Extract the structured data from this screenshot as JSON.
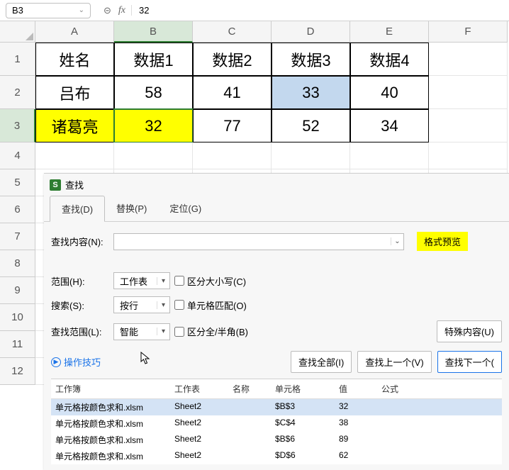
{
  "formula_bar": {
    "cell_ref": "B3",
    "value": "32"
  },
  "columns": [
    "A",
    "B",
    "C",
    "D",
    "E",
    "F"
  ],
  "selected_col": "B",
  "selected_row": 3,
  "grid": [
    [
      "姓名",
      "数据1",
      "数据2",
      "数据3",
      "数据4",
      ""
    ],
    [
      "吕布",
      "58",
      "41",
      "33",
      "40",
      ""
    ],
    [
      "诸葛亮",
      "32",
      "77",
      "52",
      "34",
      ""
    ]
  ],
  "dialog": {
    "title": "查找",
    "tabs": [
      "查找(D)",
      "替换(P)",
      "定位(G)"
    ],
    "find_label": "查找内容(N):",
    "format_preview": "格式预览",
    "scope_label": "范围(H):",
    "scope_value": "工作表",
    "search_label": "搜索(S):",
    "search_value": "按行",
    "lookin_label": "查找范围(L):",
    "lookin_value": "智能",
    "chk_case": "区分大小写(C)",
    "chk_match": "单元格匹配(O)",
    "chk_width": "区分全/半角(B)",
    "special_btn": "特殊内容(U)",
    "tips": "操作技巧",
    "find_all": "查找全部(I)",
    "find_prev": "查找上一个(V)",
    "find_next": "查找下一个("
  },
  "results": {
    "headers": {
      "wb": "工作簿",
      "ws": "工作表",
      "nm": "名称",
      "cell": "单元格",
      "val": "值",
      "fm": "公式"
    },
    "rows": [
      {
        "wb": "单元格按颜色求和.xlsm",
        "ws": "Sheet2",
        "nm": "",
        "cell": "$B$3",
        "val": "32",
        "sel": true
      },
      {
        "wb": "单元格按颜色求和.xlsm",
        "ws": "Sheet2",
        "nm": "",
        "cell": "$C$4",
        "val": "38",
        "sel": false
      },
      {
        "wb": "单元格按颜色求和.xlsm",
        "ws": "Sheet2",
        "nm": "",
        "cell": "$B$6",
        "val": "89",
        "sel": false
      },
      {
        "wb": "单元格按颜色求和.xlsm",
        "ws": "Sheet2",
        "nm": "",
        "cell": "$D$6",
        "val": "62",
        "sel": false
      }
    ]
  }
}
